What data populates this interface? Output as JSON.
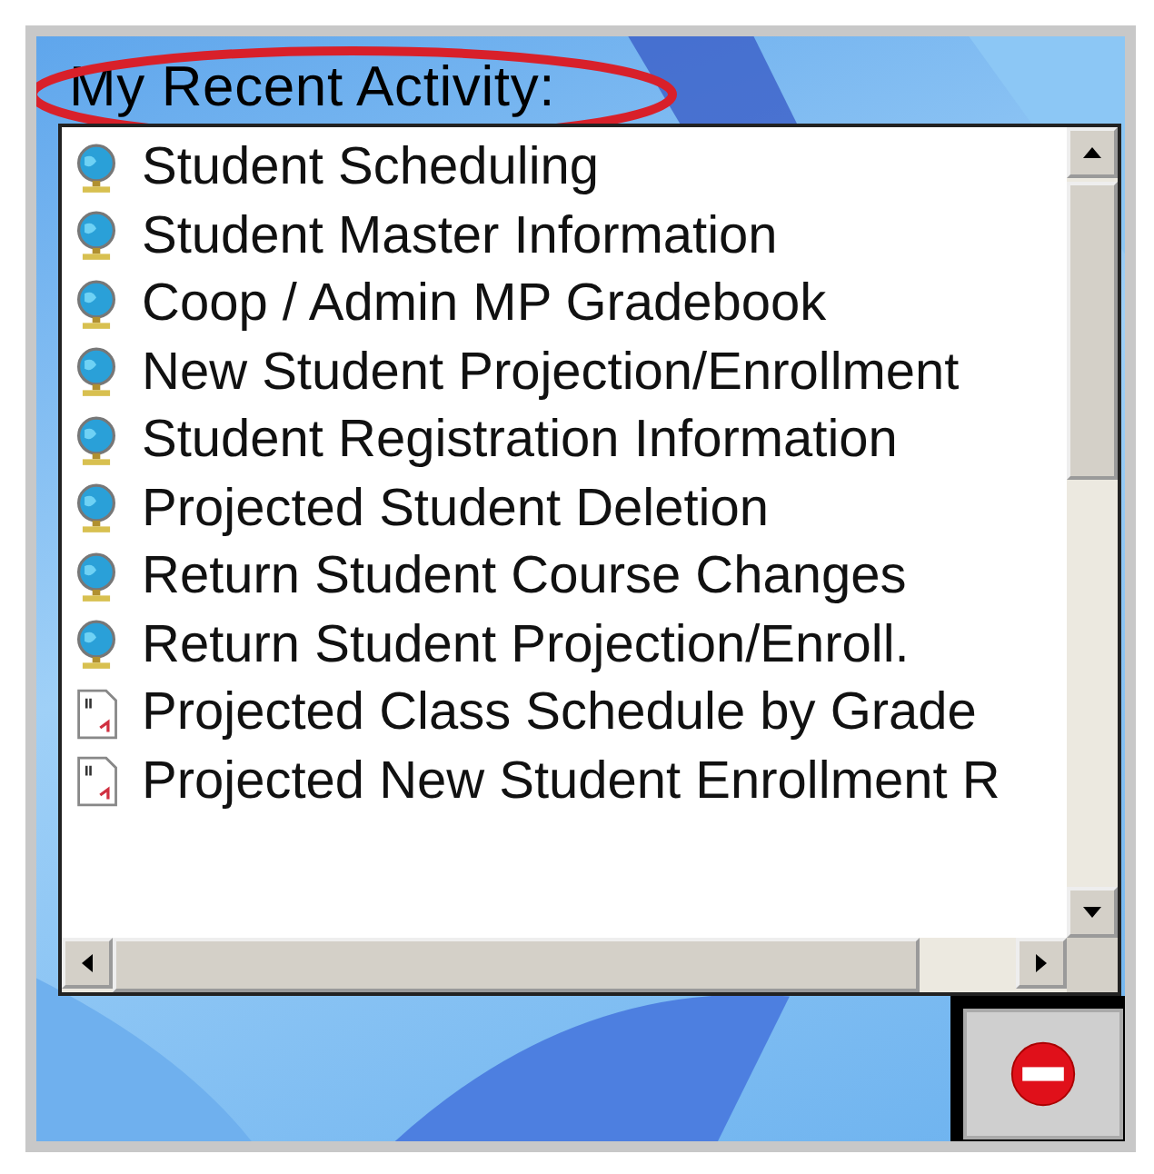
{
  "panel": {
    "title": "My Recent Activity:"
  },
  "items": [
    {
      "kind": "program",
      "label": "Student Scheduling"
    },
    {
      "kind": "program",
      "label": "Student Master Information"
    },
    {
      "kind": "program",
      "label": "Coop / Admin MP Gradebook"
    },
    {
      "kind": "program",
      "label": "New Student Projection/Enrollment"
    },
    {
      "kind": "program",
      "label": "Student Registration Information"
    },
    {
      "kind": "program",
      "label": "Projected Student Deletion"
    },
    {
      "kind": "program",
      "label": "Return Student Course Changes"
    },
    {
      "kind": "program",
      "label": "Return Student Projection/Enroll."
    },
    {
      "kind": "report",
      "label": "Projected Class Schedule by Grade"
    },
    {
      "kind": "report",
      "label": "Projected New Student Enrollment R"
    }
  ]
}
